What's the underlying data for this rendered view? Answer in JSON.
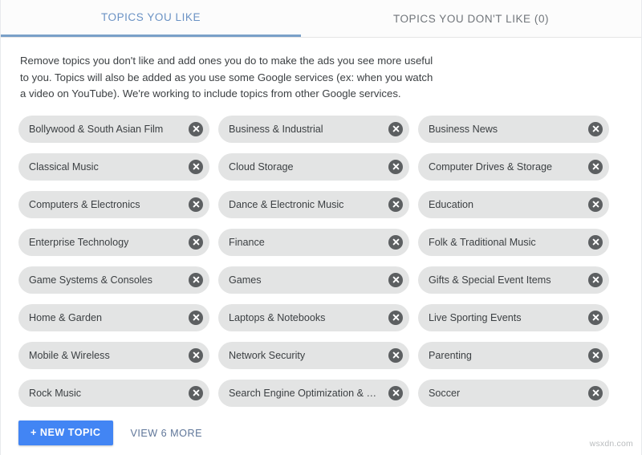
{
  "tabs": [
    {
      "id": "topics-you-like",
      "label": "TOPICS YOU LIKE",
      "active": true
    },
    {
      "id": "topics-you-dont-like",
      "label": "TOPICS YOU DON'T LIKE (0)",
      "active": false
    }
  ],
  "description": "Remove topics you don't like and add ones you do to make the ads you see more useful to you. Topics will also be added as you use some Google services (ex: when you watch a video on YouTube). We're working to include topics from other Google services.",
  "chips": [
    {
      "label": "Bollywood & South Asian Film",
      "remove_icon": "close-circle-icon"
    },
    {
      "label": "Business & Industrial",
      "remove_icon": "close-circle-icon"
    },
    {
      "label": "Business News",
      "remove_icon": "close-circle-icon"
    },
    {
      "label": "Classical Music",
      "remove_icon": "close-circle-icon"
    },
    {
      "label": "Cloud Storage",
      "remove_icon": "close-circle-icon"
    },
    {
      "label": "Computer Drives & Storage",
      "remove_icon": "close-circle-icon"
    },
    {
      "label": "Computers & Electronics",
      "remove_icon": "close-circle-icon"
    },
    {
      "label": "Dance & Electronic Music",
      "remove_icon": "close-circle-icon"
    },
    {
      "label": "Education",
      "remove_icon": "close-circle-icon"
    },
    {
      "label": "Enterprise Technology",
      "remove_icon": "close-circle-icon"
    },
    {
      "label": "Finance",
      "remove_icon": "close-circle-icon"
    },
    {
      "label": "Folk & Traditional Music",
      "remove_icon": "close-circle-icon"
    },
    {
      "label": "Game Systems & Consoles",
      "remove_icon": "close-circle-icon"
    },
    {
      "label": "Games",
      "remove_icon": "close-circle-icon"
    },
    {
      "label": "Gifts & Special Event Items",
      "remove_icon": "close-circle-icon"
    },
    {
      "label": "Home & Garden",
      "remove_icon": "close-circle-icon"
    },
    {
      "label": "Laptops & Notebooks",
      "remove_icon": "close-circle-icon"
    },
    {
      "label": "Live Sporting Events",
      "remove_icon": "close-circle-icon"
    },
    {
      "label": "Mobile & Wireless",
      "remove_icon": "close-circle-icon"
    },
    {
      "label": "Network Security",
      "remove_icon": "close-circle-icon"
    },
    {
      "label": "Parenting",
      "remove_icon": "close-circle-icon"
    },
    {
      "label": "Rock Music",
      "remove_icon": "close-circle-icon"
    },
    {
      "label": "Search Engine Optimization & Mark…",
      "remove_icon": "close-circle-icon"
    },
    {
      "label": "Soccer",
      "remove_icon": "close-circle-icon"
    }
  ],
  "actions": {
    "new_topic_label": "+ NEW TOPIC",
    "view_more_label": "VIEW 6 MORE"
  },
  "watermark": "wsxdn.com",
  "colors": {
    "accent_blue": "#4285f4",
    "tab_active": "#6a92c4",
    "tab_underline": "#7aa0c8",
    "chip_bg": "#e3e4e4",
    "chip_remove_bg": "#5c5f61",
    "text_primary": "#3c4043",
    "text_muted": "#70757a",
    "link_blue_gray": "#5f7699"
  }
}
